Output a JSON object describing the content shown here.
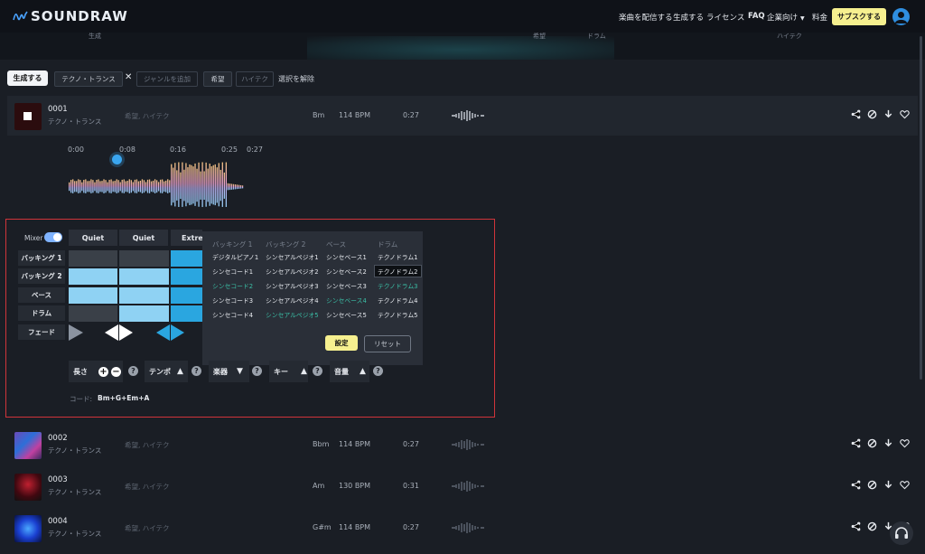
{
  "header": {
    "logo": "SOUNDRAW",
    "nav": [
      "楽曲を配信する",
      "生成する",
      "ライセンス",
      "FAQ",
      "企業向け",
      "料金"
    ],
    "subscribe": "サブスクする"
  },
  "subbar": {
    "labels": [
      "生成",
      "希望",
      "ドラム",
      "ハイテク"
    ]
  },
  "filters": {
    "generate": "生成する",
    "genre_tag": "テクノ・トランス",
    "genre_placeholder": "ジャンルを追加",
    "mood_tag": "希望",
    "theme_tag": "ハイテク",
    "clear": "選択を解除"
  },
  "tracks": [
    {
      "num": "0001",
      "genre": "テクノ・トランス",
      "mood": "希望, ハイテク",
      "key": "Bm",
      "bpm": "114 BPM",
      "dur": "0:27"
    },
    {
      "num": "0002",
      "genre": "テクノ・トランス",
      "mood": "希望, ハイテク",
      "key": "Bbm",
      "bpm": "114 BPM",
      "dur": "0:27"
    },
    {
      "num": "0003",
      "genre": "テクノ・トランス",
      "mood": "希望, ハイテク",
      "key": "Am",
      "bpm": "130 BPM",
      "dur": "0:31"
    },
    {
      "num": "0004",
      "genre": "テクノ・トランス",
      "mood": "希望, ハイテク",
      "key": "G#m",
      "bpm": "114 BPM",
      "dur": "0:27"
    }
  ],
  "player": {
    "times": [
      "0:00",
      "0:08",
      "0:16",
      "0:25",
      "0:27"
    ]
  },
  "mixer": {
    "label": "Mixer",
    "columns": [
      "Quiet",
      "Quiet",
      "Extreme"
    ],
    "rows": [
      "バッキング 1",
      "バッキング 2",
      "ベース",
      "ドラム",
      "フェード"
    ]
  },
  "instruments": {
    "headers": [
      "バッキング 1",
      "バッキング 2",
      "ベース",
      "ドラム"
    ],
    "col1": [
      "デジタルピアノ1",
      "シンセコード1",
      "シンセコード2",
      "シンセコード3",
      "シンセコード4"
    ],
    "col2": [
      "シンセアルペジオ1",
      "シンセアルペジオ2",
      "シンセアルペジオ3",
      "シンセアルペジオ4",
      "シンセアルペジオ5"
    ],
    "col3": [
      "シンセベース1",
      "シンセベース2",
      "シンセベース3",
      "シンセベース4",
      "シンセベース5"
    ],
    "col4": [
      "テクノドラム1",
      "テクノドラム2",
      "テクノドラム3",
      "テクノドラム4",
      "テクノドラム5"
    ],
    "set": "設定",
    "reset": "リセット"
  },
  "controls": {
    "length": "長さ",
    "tempo": "テンポ",
    "instrument": "楽器",
    "key": "キー",
    "volume": "音量"
  },
  "chord": {
    "label": "コード:",
    "value": "Bm+G+Em+A"
  },
  "colors": {
    "accent_yellow": "#f6f08f",
    "mixer_blue": "#2aa6e0",
    "mixer_light_blue": "#8fd2f3",
    "highlight_red": "#d0343a",
    "teal": "#3bbfa6"
  }
}
